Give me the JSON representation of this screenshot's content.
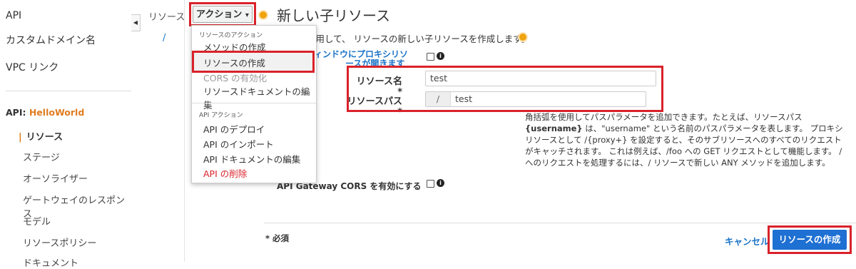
{
  "sidebar": {
    "items": [
      {
        "label": "API"
      },
      {
        "label": "カスタムドメイン名"
      },
      {
        "label": "VPC リンク"
      }
    ],
    "api_prefix": "API: ",
    "api_name": "HelloWorld",
    "sub_items": [
      {
        "label": "リソース"
      },
      {
        "label": "ステージ"
      },
      {
        "label": "オーソライザー"
      },
      {
        "label": "ゲートウェイのレスポンス"
      },
      {
        "label": "モデル"
      },
      {
        "label": "リソースポリシー"
      },
      {
        "label": "ドキュメント"
      }
    ],
    "collapse_icon": "◀"
  },
  "tree": {
    "title": "リソース",
    "root": "/"
  },
  "actions_button": {
    "label": "アクション",
    "caret": "▾"
  },
  "menu": {
    "resource_section": "リソースのアクション",
    "resource_items": [
      {
        "label": "メソッドの作成"
      },
      {
        "label": "リソースの作成"
      },
      {
        "label": "CORS の有効化"
      },
      {
        "label": "リソースドキュメントの編集"
      }
    ],
    "api_section": "API アクション",
    "api_items": [
      {
        "label": "API のデプロイ"
      },
      {
        "label": "API のインポート"
      },
      {
        "label": "API ドキュメントの編集"
      },
      {
        "label": "API の削除"
      }
    ]
  },
  "main": {
    "title": "新しい子リソース",
    "intro": "使用して、 リソースの新しい子リソースを作成します。",
    "proxy_label_line1": "ィンドウにプロキシリソ",
    "proxy_label_line2": "ースが開きます",
    "resource_name_label": "リソース名*",
    "resource_name_value": "test",
    "resource_path_label": "リソースパス*",
    "resource_path_prefix": "/",
    "resource_path_value": "test",
    "description_parts": {
      "p1": "角括弧を使用してパスパラメータを追加できます。たとえば、リソースパス ",
      "b1": "{username}",
      "p2": " は、\"username\" という名前のパスパラメータを表します。 プロキシリソースとして /{proxy+} を設定すると、そのサブリソースへのすべてのリクエストがキャッチされます。 これは例えば、/foo への GET リクエストとして機能します。 / へのリクエストを処理するには、/ リソースで新しい ANY メソッドを追加します。"
    },
    "cors_label": "API Gateway CORS を有効にする",
    "required_note": "* 必須",
    "cancel_label": "キャンセル",
    "create_label": "リソースの作成"
  },
  "colors": {
    "highlight": "#d9222a",
    "primary": "#1e70d3",
    "link": "#1a73c7",
    "api_name": "#e07b1f",
    "delete": "#d9222a"
  }
}
